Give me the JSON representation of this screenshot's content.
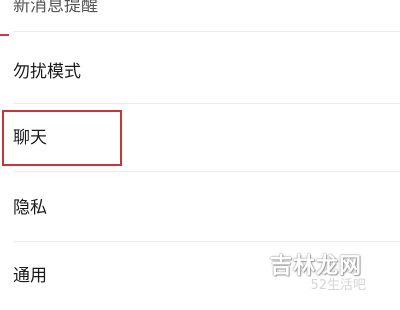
{
  "settings": {
    "items": [
      {
        "label": "新消息提醒"
      },
      {
        "label": "勿扰模式"
      },
      {
        "label": "聊天"
      },
      {
        "label": "隐私"
      },
      {
        "label": "通用"
      }
    ],
    "highlighted_item": "聊天"
  },
  "watermark": {
    "main": "吉林龙网",
    "sub": "52生活吧"
  },
  "colors": {
    "highlight": "#c8343c",
    "text": "#1a1a1a",
    "divider": "#ececec"
  }
}
